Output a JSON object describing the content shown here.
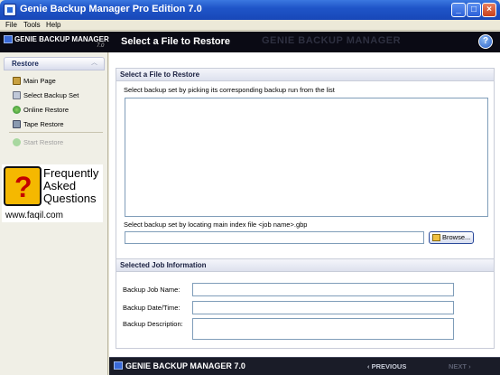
{
  "window": {
    "title": "Genie Backup Manager Pro Edition 7.0",
    "minimize": "_",
    "maximize": "□",
    "close": "×"
  },
  "menu": [
    "File",
    "Tools",
    "Help"
  ],
  "brand": {
    "name": "GENIE BACKUP MANAGER",
    "version": "7.0",
    "page_title": "Select a File to Restore",
    "watermark": "GENIE BACKUP MANAGER",
    "help": "?"
  },
  "sidebar": {
    "header": "Restore",
    "items": [
      {
        "label": "Main Page",
        "icon": "home-icon"
      },
      {
        "label": "Select Backup Set",
        "icon": "backup-set-icon"
      },
      {
        "label": "Online Restore",
        "icon": "globe-icon"
      },
      {
        "label": "Tape Restore",
        "icon": "tape-icon"
      }
    ],
    "start_restore": "Start Restore"
  },
  "watermark": {
    "line1": "Frequently",
    "line2": "Asked",
    "line3": "Questions",
    "url": "www.faqil.com"
  },
  "select_panel": {
    "header": "Select a File to Restore",
    "description": "Select backup set by picking its corresponding backup run from the list",
    "locate_label": "Select backup set by locating main index file <job name>.gbp",
    "file_value": "",
    "browse_label": "Browse..."
  },
  "job_panel": {
    "header": "Selected Job Information",
    "fields": [
      {
        "label": "Backup Job Name:",
        "value": ""
      },
      {
        "label": "Backup Date/Time:",
        "value": ""
      },
      {
        "label": "Backup Description:",
        "value": ""
      }
    ]
  },
  "footer": {
    "brand": "GENIE BACKUP MANAGER 7.0",
    "previous": "PREVIOUS",
    "next": "NEXT"
  }
}
